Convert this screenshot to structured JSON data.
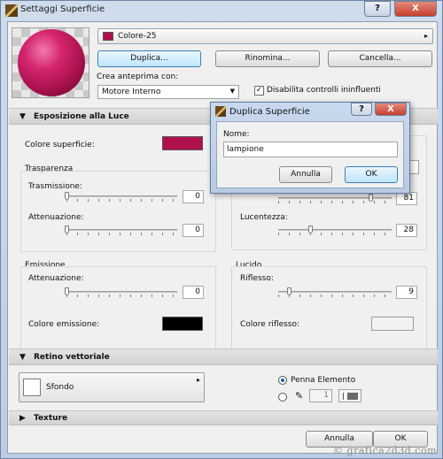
{
  "window": {
    "title": "Settaggi Superficie",
    "help_glyph": "?",
    "close_glyph": "X"
  },
  "top": {
    "surface_name": "Colore-25",
    "surface_color": "#b0104e",
    "duplicate_label": "Duplica...",
    "rename_label": "Rinomina...",
    "delete_label": "Cancella...",
    "preview_label": "Crea anteprima con:",
    "engine_value": "Motore Interno",
    "disable_controls_label": "Disabilita controlli ininfluenti",
    "disable_controls_checked": true
  },
  "light_section": {
    "title": "Esposizione alla Luce",
    "surface_color_label": "Colore superficie:",
    "surface_color": "#b0104e",
    "transparency": {
      "title": "Trasparenza",
      "transmission_label": "Trasmissione:",
      "transmission_value": "0",
      "attenuation_label": "Attenuazione:",
      "attenuation_value": "0"
    },
    "right": {
      "top_value": "81",
      "gloss_label": "Lucentezza:",
      "gloss_value": "28"
    },
    "emission": {
      "title": "Emissione",
      "attenuation_label": "Attenuazione:",
      "attenuation_value": "0",
      "color_label": "Colore emissione:",
      "color": "#000000"
    },
    "shine": {
      "title": "Lucido",
      "reflection_label": "Riflesso:",
      "reflection_value": "9",
      "reflection_color_label": "Colore riflesso:",
      "reflection_color": "#f2f2f2"
    }
  },
  "vector_section": {
    "title": "Retino vettoriale",
    "fill_label": "Sfondo",
    "pen_label": "Penna Elemento",
    "pen_number": "1",
    "pen_selected": "element"
  },
  "texture_section": {
    "title": "Texture"
  },
  "footer": {
    "cancel_label": "Annulla",
    "ok_label": "OK"
  },
  "dialog": {
    "title": "Duplica Superficie",
    "help_glyph": "?",
    "close_glyph": "X",
    "name_label": "Nome:",
    "name_value": "lampione",
    "cancel_label": "Annulla",
    "ok_label": "OK"
  },
  "watermark": "© grafica2d3d.com",
  "colors": {
    "accent": "#3c7fb1",
    "surface": "#b0104e"
  }
}
